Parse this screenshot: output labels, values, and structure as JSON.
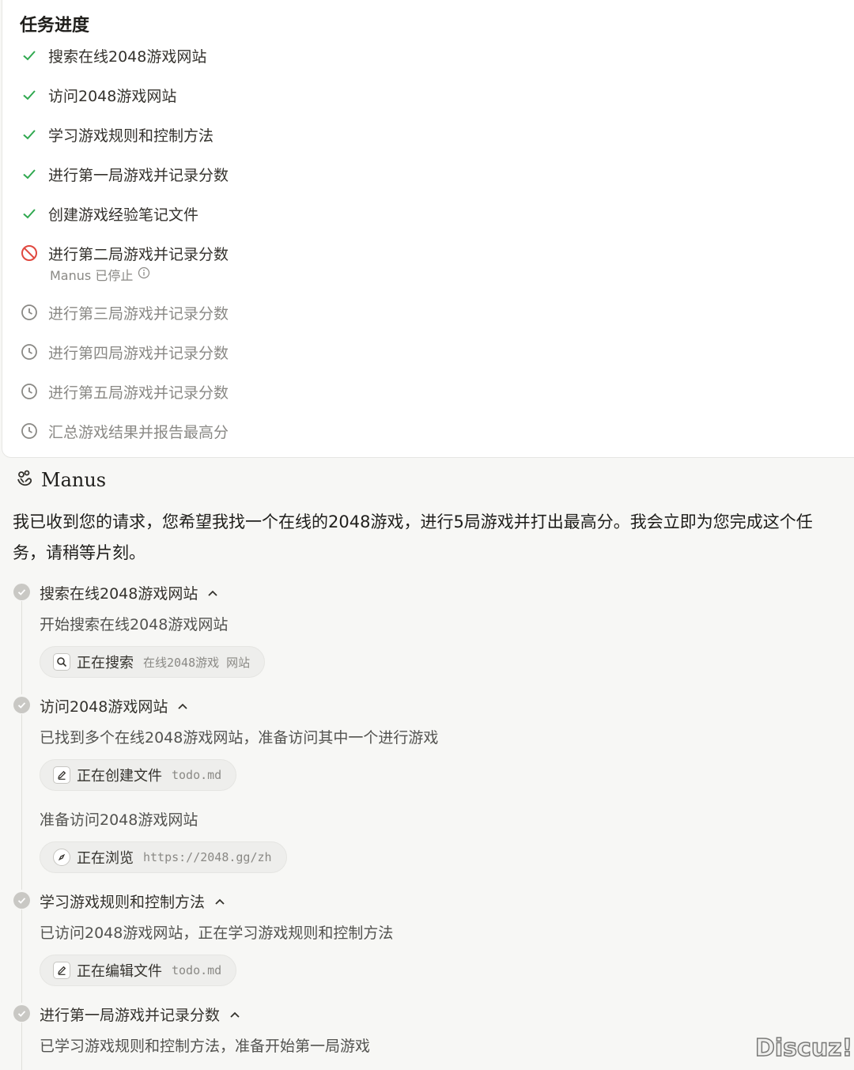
{
  "task_panel": {
    "title": "任务进度",
    "items": [
      {
        "label": "搜索在线2048游戏网站",
        "status": "done"
      },
      {
        "label": "访问2048游戏网站",
        "status": "done"
      },
      {
        "label": "学习游戏规则和控制方法",
        "status": "done"
      },
      {
        "label": "进行第一局游戏并记录分数",
        "status": "done"
      },
      {
        "label": "创建游戏经验笔记文件",
        "status": "done"
      },
      {
        "label": "进行第二局游戏并记录分数",
        "status": "stopped",
        "sub": "Manus 已停止"
      },
      {
        "label": "进行第三局游戏并记录分数",
        "status": "pending"
      },
      {
        "label": "进行第四局游戏并记录分数",
        "status": "pending"
      },
      {
        "label": "进行第五局游戏并记录分数",
        "status": "pending"
      },
      {
        "label": "汇总游戏结果并报告最高分",
        "status": "pending"
      }
    ]
  },
  "manus": {
    "name": "Manus",
    "message": "我已收到您的请求，您希望我找一个在线的2048游戏，进行5局游戏并打出最高分。我会立即为您完成这个任务，请稍等片刻。"
  },
  "steps": [
    {
      "title": "搜索在线2048游戏网站",
      "desc": "开始搜索在线2048游戏网站",
      "action": {
        "icon": "search-icon",
        "label": "正在搜索",
        "arg": "在线2048游戏 网站"
      }
    },
    {
      "title": "访问2048游戏网站",
      "desc": "已找到多个在线2048游戏网站，准备访问其中一个进行游戏",
      "action": {
        "icon": "edit-icon",
        "label": "正在创建文件",
        "arg": "todo.md"
      },
      "desc2": "准备访问2048游戏网站",
      "action2": {
        "icon": "compass-icon",
        "label": "正在浏览",
        "arg": "https://2048.gg/zh"
      }
    },
    {
      "title": "学习游戏规则和控制方法",
      "desc": "已访问2048游戏网站，正在学习游戏规则和控制方法",
      "action": {
        "icon": "edit-icon",
        "label": "正在编辑文件",
        "arg": "todo.md"
      }
    },
    {
      "title": "进行第一局游戏并记录分数",
      "desc": "已学习游戏规则和控制方法，准备开始第一局游戏"
    }
  ],
  "watermark": "Discuz!",
  "colors": {
    "check": "#2fa84f",
    "stop": "#e0483f",
    "pending": "#8a8985",
    "dot": "#c9c8c4"
  }
}
